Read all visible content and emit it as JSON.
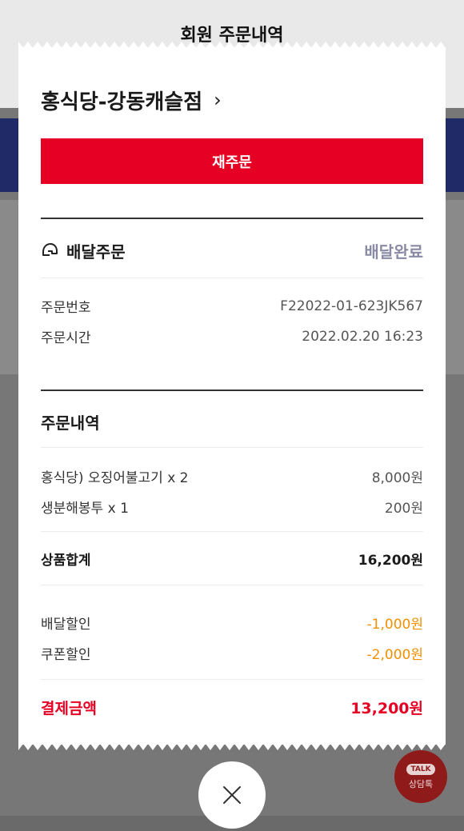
{
  "background": {
    "title": "회원 주문내역"
  },
  "receipt": {
    "store_name": "홍식당-강동캐슬점",
    "reorder_label": "재주문",
    "delivery": {
      "type": "배달주문",
      "status": "배달완료",
      "icon": "helmet-icon"
    },
    "order_info": {
      "number_label": "주문번호",
      "number_value": "F22022-01-623JK567",
      "time_label": "주문시간",
      "time_value": "2022.02.20 16:23"
    },
    "items_title": "주문내역",
    "items": [
      {
        "name": "홍식당) 오징어불고기 x 2",
        "price": "8,000원"
      },
      {
        "name": "생분해봉투 x 1",
        "price": "200원"
      }
    ],
    "subtotal_label": "상품합계",
    "subtotal_value": "16,200원",
    "discounts": [
      {
        "label": "배달할인",
        "value": "-1,000원"
      },
      {
        "label": "쿠폰할인",
        "value": "-2,000원"
      }
    ],
    "payment_label": "결제금액",
    "payment_value": "13,200원"
  },
  "talk_button": {
    "badge": "TALK",
    "label": "상담톡"
  },
  "colors": {
    "accent_red": "#e60023",
    "discount_orange": "#f09000",
    "status_gray": "#8a8aa5"
  }
}
